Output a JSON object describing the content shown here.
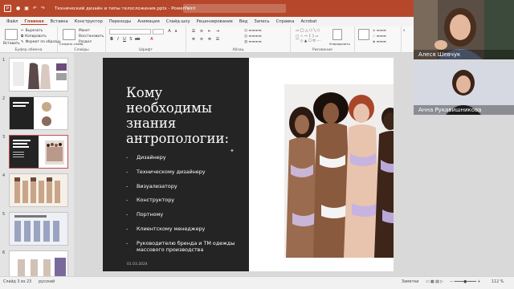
{
  "titlebar": {
    "app_icon": "P",
    "title": "Технический дизайн и типы телосложения.pptx  -  PowerPoint",
    "search_placeholder": ""
  },
  "ribbon_tabs": [
    "Файл",
    "Главная",
    "Вставка",
    "Конструктор",
    "Переходы",
    "Анимация",
    "Слайд-шоу",
    "Рецензирование",
    "Вид",
    "Запись",
    "Справка",
    "Acrobat"
  ],
  "ribbon": {
    "clipboard": {
      "label": "Буфер обмена",
      "paste": "Вставить",
      "cut": "Вырезать",
      "copy": "Копировать",
      "format": "Формат по образцу"
    },
    "slides": {
      "label": "Слайды",
      "new": "Создать слайд",
      "layout": "Макет",
      "reset": "Восстановить",
      "section": "Раздел"
    },
    "font": {
      "label": "Шрифт"
    },
    "paragraph": {
      "label": "Абзац"
    },
    "drawing": {
      "label": "Рисование",
      "arrange": "Упорядочить"
    },
    "editing": {
      "label": "Редактирование",
      "find": "Найти",
      "replace": "Заменить",
      "select": "Выделить"
    },
    "designer": {
      "label": "Дизайнер"
    }
  },
  "slide": {
    "title": "Кому необходимы знания антропологии:",
    "bullets": [
      "Дизайнеру",
      "Техническому дизайнеру",
      "Визуализатору",
      "Конструктору",
      "Портному",
      "Клиентскому менеджеру",
      "Руководителю бренда и ТМ одежды массового производства"
    ],
    "date": "01.03.2024"
  },
  "thumbnails": [
    "1",
    "2",
    "3",
    "4",
    "5",
    "6"
  ],
  "participants": [
    {
      "name": "Алеся Шевчук"
    },
    {
      "name": "Анна Рукавишникова"
    }
  ],
  "statusbar": {
    "slide_info": "Слайд 3 из 23",
    "language": "русский",
    "notes": "Заметки",
    "zoom": "112 %"
  },
  "colors": {
    "accent": "#b7472a",
    "slide_dark": "#242424"
  }
}
